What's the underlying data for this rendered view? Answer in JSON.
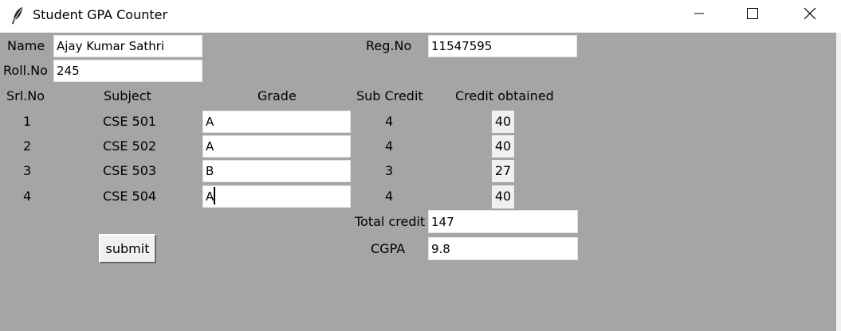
{
  "window": {
    "title": "Student GPA Counter",
    "icons": {
      "app": "feather-icon",
      "minimize": "minimize-icon",
      "maximize": "maximize-icon",
      "close": "close-icon"
    }
  },
  "student": {
    "name_label": "Name",
    "name_value": "Ajay Kumar Sathri",
    "regno_label": "Reg.No",
    "regno_value": "11547595",
    "rollno_label": "Roll.No",
    "rollno_value": "245"
  },
  "table": {
    "headers": {
      "srl": "Srl.No",
      "subject": "Subject",
      "grade": "Grade",
      "sub_credit": "Sub Credit",
      "credit_obtained": "Credit obtained"
    },
    "rows": [
      {
        "srl": "1",
        "subject": "CSE 501",
        "grade": "A",
        "sub_credit": "4",
        "credit_obtained": "40"
      },
      {
        "srl": "2",
        "subject": "CSE 502",
        "grade": "A",
        "sub_credit": "4",
        "credit_obtained": "40"
      },
      {
        "srl": "3",
        "subject": "CSE 503",
        "grade": "B",
        "sub_credit": "3",
        "credit_obtained": "27"
      },
      {
        "srl": "4",
        "subject": "CSE 504",
        "grade": "A",
        "sub_credit": "4",
        "credit_obtained": "40"
      }
    ]
  },
  "summary": {
    "total_credit_label": "Total credit",
    "total_credit_value": "147",
    "cgpa_label": "CGPA",
    "cgpa_value": "9.8"
  },
  "actions": {
    "submit_label": "submit"
  }
}
